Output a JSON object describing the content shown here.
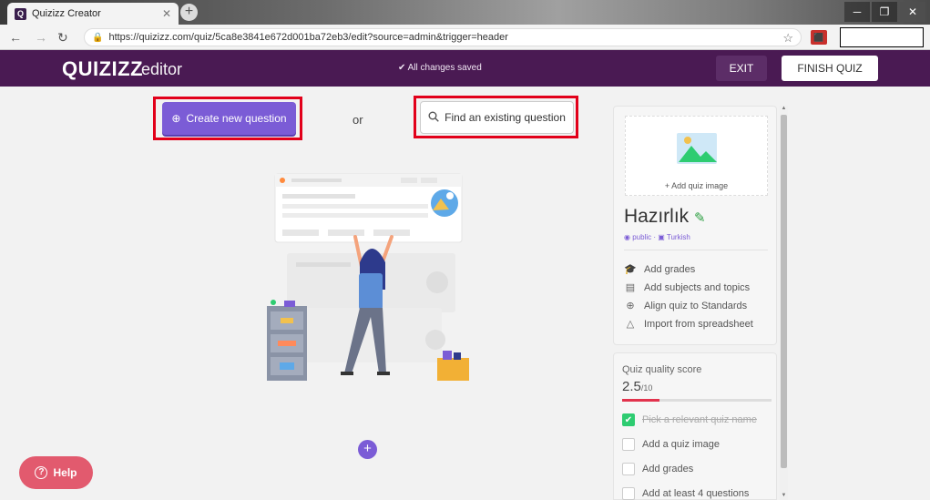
{
  "browser": {
    "tab_title": "Quizizz Creator",
    "tab_favicon": "Q",
    "url": "https://quizizz.com/quiz/5ca8e3841e672d001ba72eb3/edit?source=admin&trigger=header"
  },
  "header": {
    "logo": "QUIZIZZ",
    "logo_sub": "editor",
    "status": "All changes saved",
    "exit_label": "EXIT",
    "finish_label": "FINISH QUIZ"
  },
  "main": {
    "create_label": "Create new question",
    "or_label": "or",
    "find_label": "Find an existing question",
    "help_label": "Help"
  },
  "panel": {
    "add_image_label": "+ Add quiz image",
    "quiz_title": "Hazırlık",
    "visibility": "public",
    "language": "Turkish",
    "actions": [
      {
        "icon": "graduation-cap-icon",
        "label": "Add grades"
      },
      {
        "icon": "book-icon",
        "label": "Add subjects and topics"
      },
      {
        "icon": "plus-circle-icon",
        "label": "Align quiz to Standards"
      },
      {
        "icon": "drive-icon",
        "label": "Import from spreadsheet"
      }
    ],
    "quality": {
      "title": "Quiz quality score",
      "score": "2.5",
      "max": "/10",
      "fraction": 0.25,
      "checklist": [
        {
          "label": "Pick a relevant quiz name",
          "done": true
        },
        {
          "label": "Add a quiz image",
          "done": false
        },
        {
          "label": "Add grades",
          "done": false
        },
        {
          "label": "Add at least 4 questions",
          "done": false
        }
      ]
    }
  },
  "colors": {
    "header": "#4a1a53",
    "accent": "#7b5cd6",
    "highlight": "#e2001a",
    "help": "#e25a6e",
    "score_bar": "#e2334d"
  }
}
